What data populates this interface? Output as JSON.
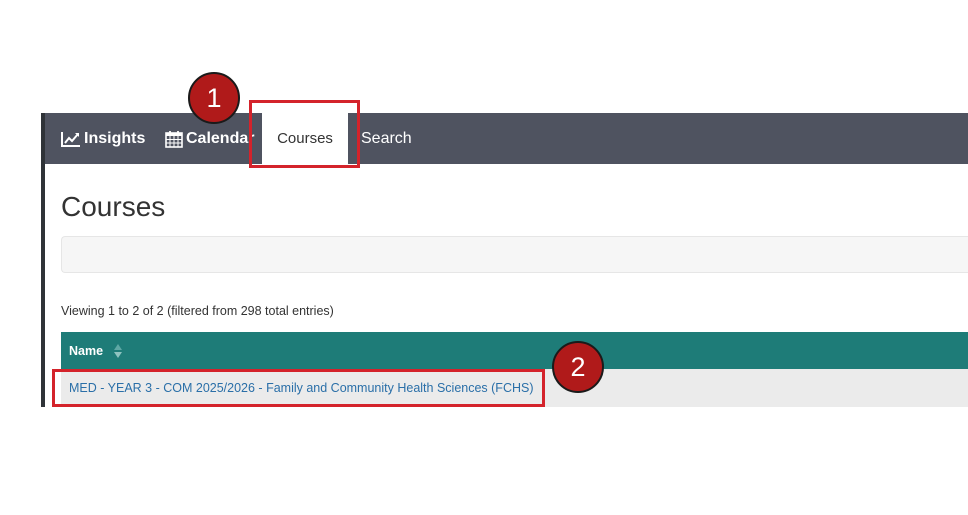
{
  "navbar": {
    "items": [
      {
        "label": "Insights",
        "icon": "line-chart-icon"
      },
      {
        "label": "Calendar",
        "icon": "calendar-icon"
      },
      {
        "label": "Courses",
        "active": true
      },
      {
        "label": "Search"
      }
    ]
  },
  "page": {
    "title": "Courses",
    "viewing_text": "Viewing 1 to 2 of 2 (filtered from 298 total entries)"
  },
  "table": {
    "columns": [
      "Name"
    ],
    "rows": [
      {
        "name": "MED - YEAR 3 - COM 2025/2026 - Family and Community Health Sciences (FCHS)"
      }
    ]
  },
  "annotations": {
    "badges": [
      "1",
      "2"
    ],
    "color": "#d4232b"
  },
  "colors": {
    "navbar": "#4f5360",
    "table_header": "#1e7c78",
    "link": "#2a6fa8",
    "badge": "#b01a1a"
  }
}
